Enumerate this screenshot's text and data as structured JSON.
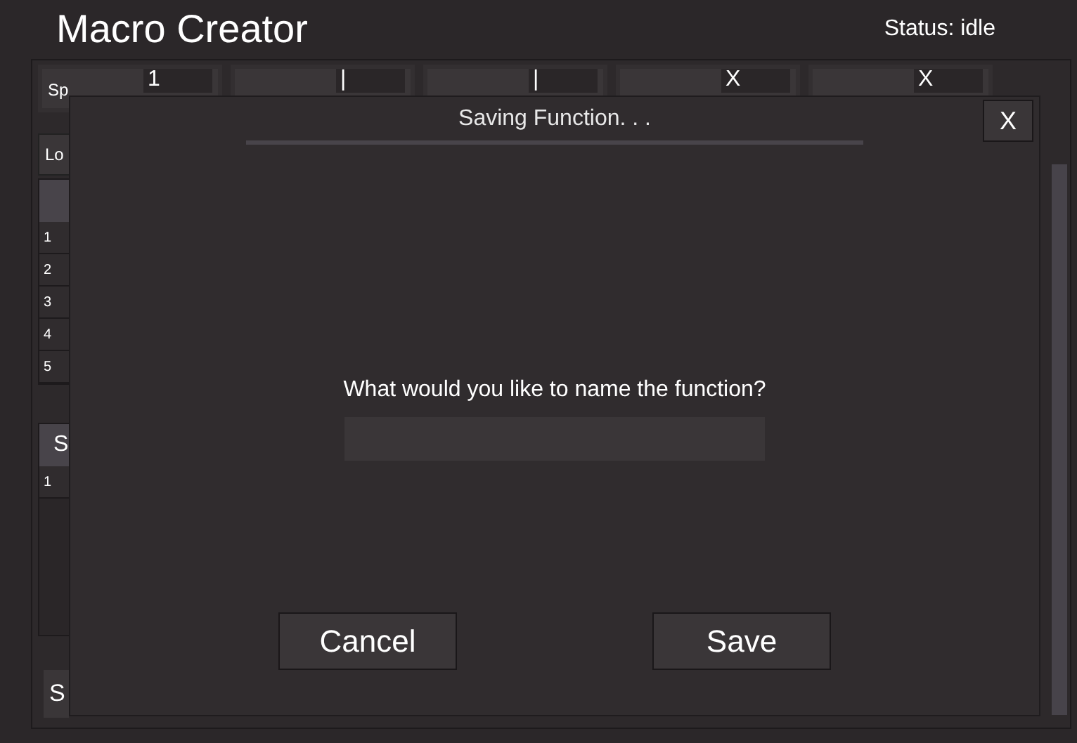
{
  "window": {
    "title": "Macro Creator",
    "status": "Status: idle"
  },
  "top_fields": [
    {
      "label": "Sp",
      "value": "1"
    },
    {
      "value": "|"
    },
    {
      "value": "|"
    },
    {
      "value": "X"
    },
    {
      "value": "X"
    }
  ],
  "side_buttons": [
    {
      "label": "Lo"
    }
  ],
  "table_1": {
    "rows": [
      "1",
      "2",
      "3",
      "4",
      "5"
    ]
  },
  "table_2": {
    "header": "S",
    "rows": [
      "1"
    ]
  },
  "bottom_button": {
    "label": "S"
  },
  "dialog": {
    "title": "Saving Function. . .",
    "close": "X",
    "prompt": "What would you like to name the function?",
    "buttons": [
      {
        "label": "Cancel"
      },
      {
        "label": "Save"
      }
    ]
  }
}
